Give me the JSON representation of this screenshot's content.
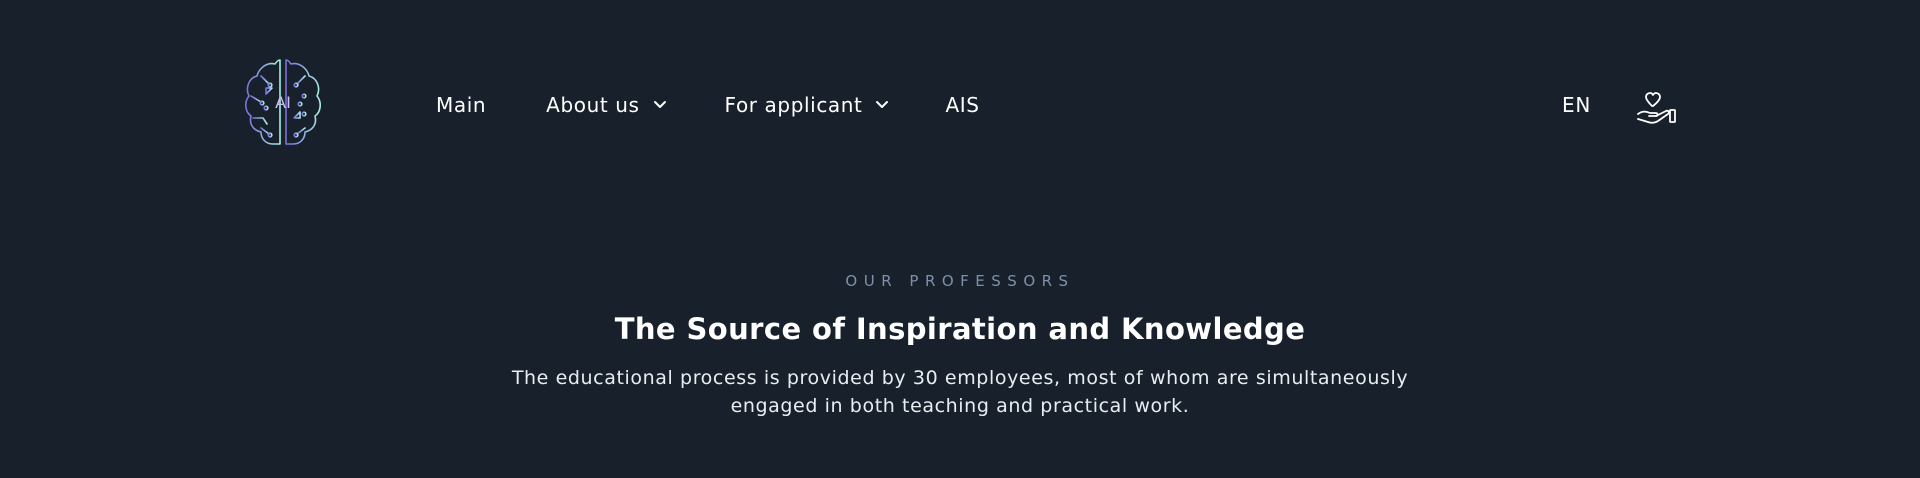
{
  "colors": {
    "background": "#18212b",
    "text": "#ffffff",
    "eyebrow": "#7f90ab",
    "logo_gradient_start": "#7b6fd6",
    "logo_gradient_end": "#a8f0e0"
  },
  "header": {
    "logo": {
      "text": "AI",
      "icon": "brain-circuit-logo"
    },
    "nav": [
      {
        "label": "Main",
        "has_dropdown": false
      },
      {
        "label": "About us",
        "has_dropdown": true
      },
      {
        "label": "For applicant",
        "has_dropdown": true
      },
      {
        "label": "AIS",
        "has_dropdown": false
      }
    ],
    "language": "EN",
    "donate_icon": "heart-in-hand-icon"
  },
  "section": {
    "eyebrow": "OUR PROFESSORS",
    "title": "The Source of Inspiration and Knowledge",
    "subtitle": "The educational process is provided by 30 employees, most of whom are simultaneously engaged in both teaching and practical work."
  }
}
